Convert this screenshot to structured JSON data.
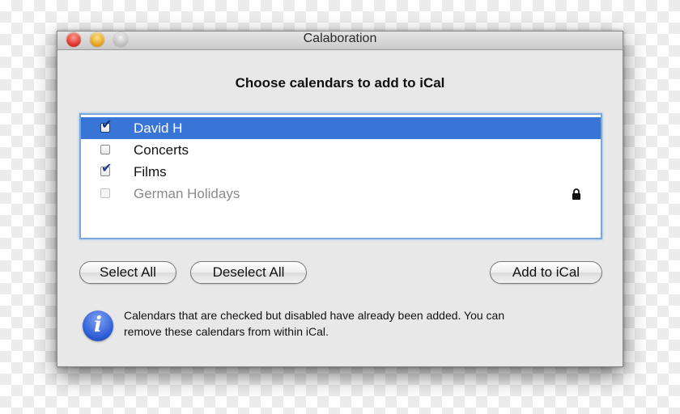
{
  "window": {
    "title": "Calaboration"
  },
  "dialog": {
    "heading": "Choose calendars to add to iCal"
  },
  "calendars": [
    {
      "label": "David H",
      "checked": true,
      "selected": true,
      "disabled": false,
      "locked": false
    },
    {
      "label": "Concerts",
      "checked": false,
      "selected": false,
      "disabled": false,
      "locked": false
    },
    {
      "label": "Films",
      "checked": true,
      "selected": false,
      "disabled": false,
      "locked": false
    },
    {
      "label": "German Holidays",
      "checked": false,
      "selected": false,
      "disabled": true,
      "locked": true
    }
  ],
  "buttons": {
    "select_all": "Select All",
    "deselect_all": "Deselect All",
    "add_to_ical": "Add to iCal"
  },
  "info": {
    "icon_letter": "i",
    "line1": "Calendars that are checked but disabled have already been added. You can",
    "line2": "remove these calendars from within iCal."
  },
  "icons": {
    "close": "close-icon",
    "minimize": "minimize-icon",
    "zoom": "zoom-icon",
    "check": "checkmark-icon",
    "lock": "lock-icon",
    "info": "info-icon"
  },
  "colors": {
    "selection": "#3875d7",
    "list_border": "#79a7e0",
    "info_icon": "#2f5ed6"
  }
}
